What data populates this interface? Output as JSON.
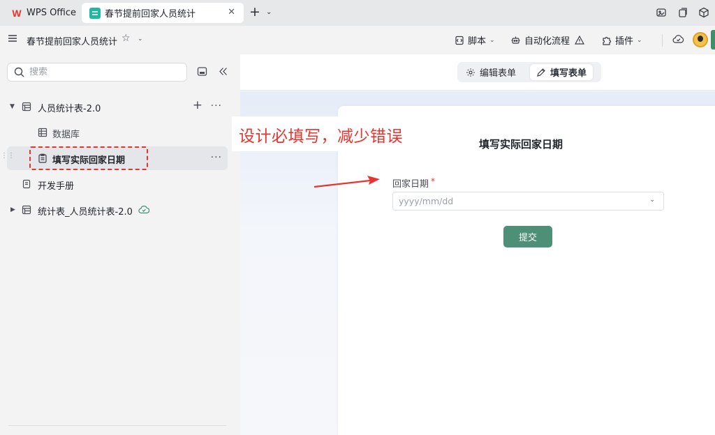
{
  "tabs": {
    "wps": "WPS Office",
    "active": "春节提前回家人员统计",
    "close": "✕",
    "new": "+",
    "new_menu": "⌄"
  },
  "toolbar": {
    "doc_title": "春节提前回家人员统计",
    "star": "☆",
    "script": "脚本",
    "automation": "自动化流程",
    "plugins": "插件",
    "caret": "⌄"
  },
  "sidebar": {
    "search_placeholder": "搜索",
    "items": [
      {
        "label": "人员统计表-2.0",
        "caret": "▼"
      },
      {
        "label": "数据库"
      },
      {
        "label": "填写实际回家日期"
      },
      {
        "label": "开发手册"
      },
      {
        "label": "统计表_人员统计表-2.0",
        "caret": "▶"
      }
    ],
    "more": "···",
    "add": "+"
  },
  "main": {
    "mode_tabs": [
      "编辑表单",
      "填写表单"
    ],
    "form": {
      "title": "填写实际回家日期",
      "field_label": "回家日期",
      "required_mark": "*",
      "date_placeholder": "yyyy/mm/dd",
      "submit": "提交"
    }
  },
  "annotation": {
    "text": "设计必填写，减少错误",
    "color": "#e8332f"
  },
  "colors": {
    "brand_green": "#4e8f78",
    "annotation_red": "#e8332f"
  }
}
